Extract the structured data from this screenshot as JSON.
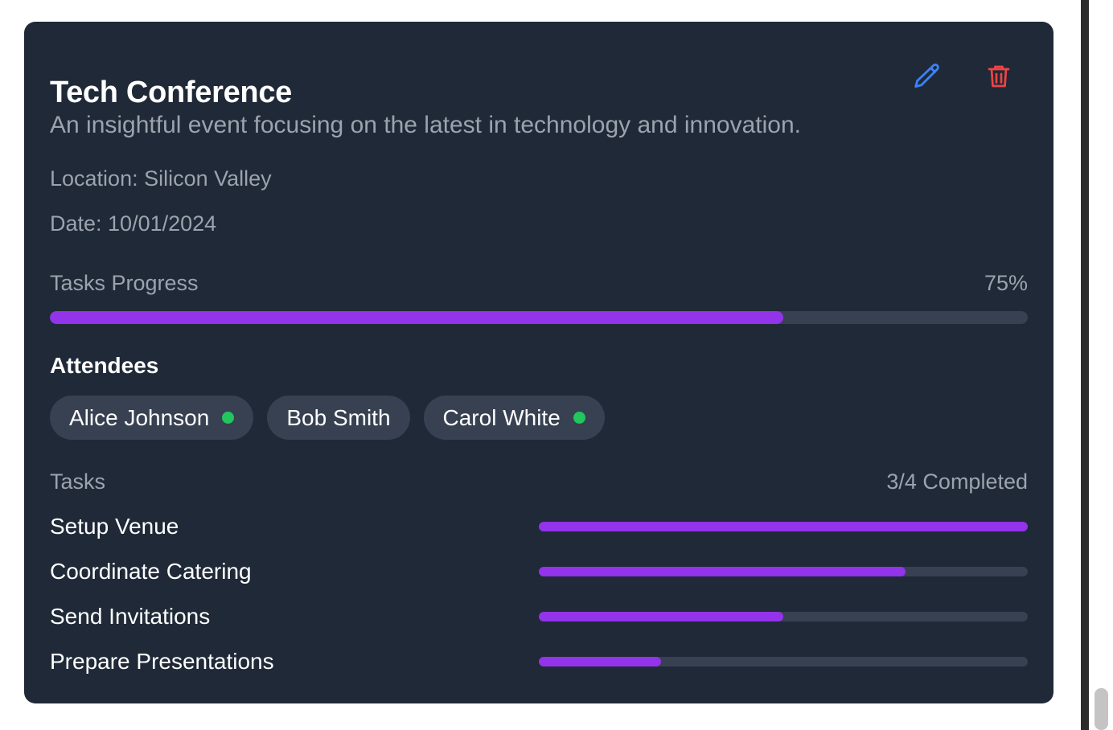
{
  "event": {
    "title": "Tech Conference",
    "description": "An insightful event focusing on the latest in technology and innovation.",
    "location": "Location: Silicon Valley",
    "date": "Date: 10/01/2024"
  },
  "actions": {
    "edit_icon": "pencil-icon",
    "delete_icon": "trash-icon",
    "edit_color": "#3b82f6",
    "delete_color": "#ef4444"
  },
  "progress": {
    "label": "Tasks Progress",
    "percent_text": "75%",
    "value": 0.75
  },
  "attendees": {
    "title": "Attendees",
    "people": [
      {
        "name": "Alice Johnson",
        "online": true
      },
      {
        "name": "Bob Smith",
        "online": false
      },
      {
        "name": "Carol White",
        "online": true
      }
    ]
  },
  "tasks": {
    "label": "Tasks",
    "count_text": "3/4 Completed",
    "items": [
      {
        "name": "Setup Venue",
        "progress": 1.0
      },
      {
        "name": "Coordinate Catering",
        "progress": 0.75
      },
      {
        "name": "Send Invitations",
        "progress": 0.5
      },
      {
        "name": "Prepare Presentations",
        "progress": 0.25
      }
    ]
  },
  "colors": {
    "card_bg": "#1f2937",
    "accent": "#9333ea",
    "track": "#374151",
    "online": "#22c55e"
  }
}
